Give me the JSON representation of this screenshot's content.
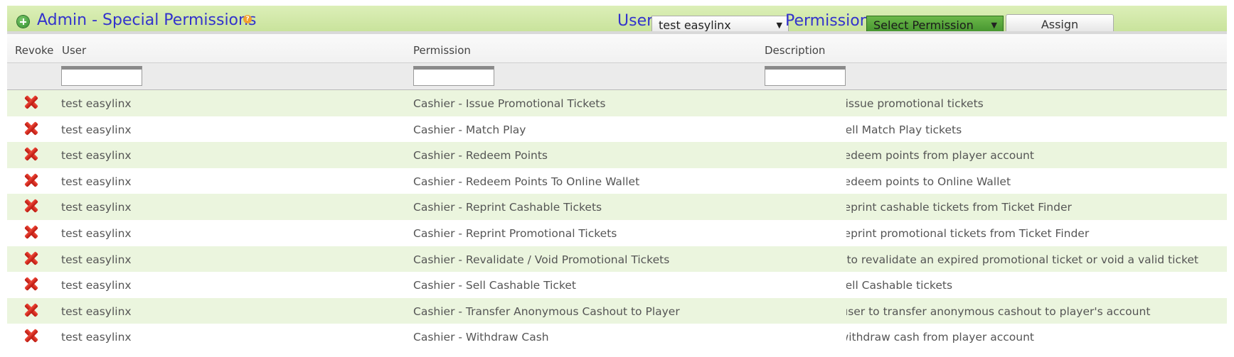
{
  "header": {
    "title": "Admin - Special Permissions",
    "help_glyph": "?",
    "user_label": "User:",
    "user_value": "test easylinx",
    "permission_label": "Permission:",
    "permission_value": "Select Permission",
    "assign_label": "Assign",
    "select_arrow": "▼"
  },
  "columns": {
    "revoke": "Revoke",
    "user": "User",
    "permission": "Permission",
    "description": "Description"
  },
  "rows": [
    {
      "user": "test easylinx",
      "permission": "Cashier - Issue Promotional Tickets",
      "description": "Allows user to issue promotional tickets"
    },
    {
      "user": "test easylinx",
      "permission": "Cashier - Match Play",
      "description": "Allow user to sell Match Play tickets"
    },
    {
      "user": "test easylinx",
      "permission": "Cashier - Redeem Points",
      "description": "Allow user to redeem points from player account"
    },
    {
      "user": "test easylinx",
      "permission": "Cashier - Redeem Points To Online Wallet",
      "description": "Allow user to redeem points to Online Wallet"
    },
    {
      "user": "test easylinx",
      "permission": "Cashier - Reprint Cashable Tickets",
      "description": "Allow user to reprint cashable tickets from Ticket Finder"
    },
    {
      "user": "test easylinx",
      "permission": "Cashier - Reprint Promotional Tickets",
      "description": "Allow user to reprint promotional tickets from Ticket Finder"
    },
    {
      "user": "test easylinx",
      "permission": "Cashier - Revalidate / Void Promotional Tickets",
      "description": "Allows cashier to revalidate an expired promotional ticket or void a valid ticket"
    },
    {
      "user": "test easylinx",
      "permission": "Cashier - Sell Cashable Ticket",
      "description": "Allow user to sell Cashable tickets"
    },
    {
      "user": "test easylinx",
      "permission": "Cashier - Transfer Anonymous Cashout to Player",
      "description": "Allow cashier user to transfer anonymous cashout to player's account"
    },
    {
      "user": "test easylinx",
      "permission": "Cashier - Withdraw Cash",
      "description": "Allow user to withdraw cash from player account"
    }
  ],
  "icons": {
    "add": "add-icon",
    "help": "help-icon",
    "revoke": "revoke-x-icon"
  },
  "colors": {
    "header_bg": "#c9e39c",
    "title_blue": "#3333cc",
    "alt_row": "#ebf5de",
    "revoke_red": "#d42a1e",
    "permission_select": "#4f9f35"
  }
}
